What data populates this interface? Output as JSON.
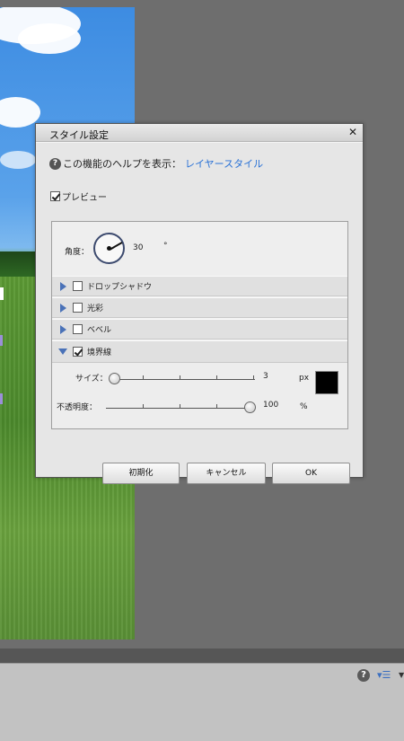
{
  "dialog": {
    "title": "スタイル設定",
    "help_text": "この機能のヘルプを表示：",
    "help_link": "レイヤースタイル",
    "preview_label": "プレビュー",
    "preview_checked": true
  },
  "angle": {
    "label": "角度：",
    "value": "30",
    "unit": "°"
  },
  "sections": [
    {
      "label": "ドロップシャドウ",
      "checked": false,
      "expanded": false
    },
    {
      "label": "光彩",
      "checked": false,
      "expanded": false
    },
    {
      "label": "ベベル",
      "checked": false,
      "expanded": false
    },
    {
      "label": "境界線",
      "checked": true,
      "expanded": true
    }
  ],
  "stroke": {
    "size_label": "サイズ：",
    "size_value": "3",
    "size_unit": "px",
    "size_level": 0.03,
    "opacity_label": "不透明度：",
    "opacity_value": "100",
    "opacity_unit": "%",
    "opacity_level": 1.0,
    "color": "#000000"
  },
  "buttons": {
    "reset": "初期化",
    "cancel": "キャンセル",
    "ok": "OK"
  },
  "colors": {
    "link": "#2a72d6",
    "expand_triangle": "#4a72b8"
  },
  "icons": [
    "help-icon",
    "close-icon",
    "panel-menu-icon"
  ]
}
